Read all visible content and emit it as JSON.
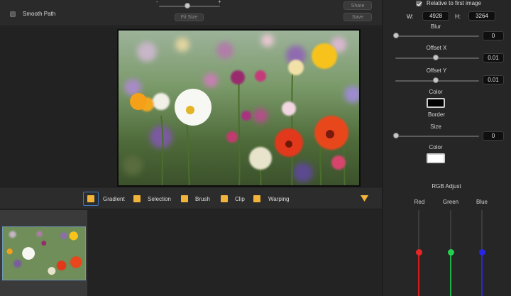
{
  "toolbar_top": {
    "smooth_path_label": "Smooth Path",
    "zoom_minus": "-",
    "zoom_plus": "+",
    "fit_size_label": "Fit Size",
    "share_label": "Share",
    "save_label": "Save"
  },
  "right_panel": {
    "relative_label": "Relative to first image",
    "width_label": "W:",
    "width_value": "4928",
    "height_label": "H:",
    "height_value": "3264",
    "blur_label": "Blur",
    "blur_value": "0",
    "offset_x_label": "Offset X",
    "offset_x_value": "0.01",
    "offset_y_label": "Offset Y",
    "offset_y_value": "0.01",
    "shadow_color_label": "Color",
    "border_label": "Border",
    "size_label": "Size",
    "size_value": "0",
    "border_color_label": "Color",
    "rgb_adjust_label": "RGB Adjust",
    "red_label": "Red",
    "green_label": "Green",
    "blue_label": "Blue"
  },
  "tools": [
    {
      "label": "Gradient"
    },
    {
      "label": "Selection"
    },
    {
      "label": "Brush"
    },
    {
      "label": "Clip"
    },
    {
      "label": "Warping"
    }
  ],
  "colors": {
    "accent": "#f2b33a",
    "red": "#e02020",
    "green": "#22c84a",
    "blue": "#2222dd"
  },
  "icons": {
    "expand": "triangle-down-icon"
  }
}
